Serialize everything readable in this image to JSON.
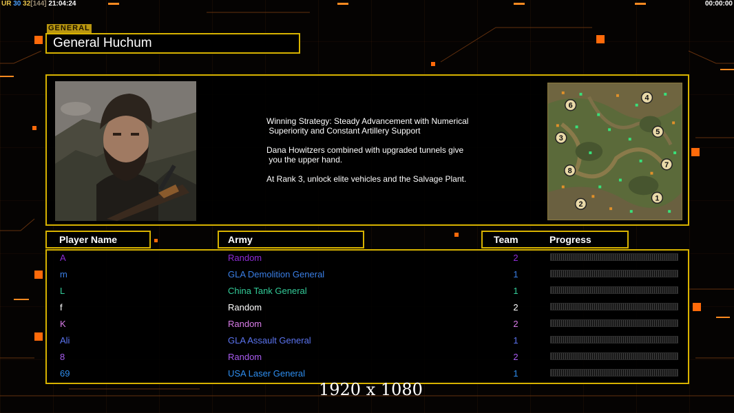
{
  "hud": {
    "left": {
      "tag": "UR",
      "a": "30",
      "b": "32",
      "c": "[144]",
      "clock": "21:04:24"
    },
    "right_timer": "00:00:00"
  },
  "section_tag": "GENERAL",
  "general_name": "General Huchum",
  "description": [
    "Winning Strategy: Steady Advancement with Numerical\n Superiority and Constant Artillery Support",
    "Dana Howitzers combined with upgraded tunnels give\n you the upper hand.",
    "At Rank 3, unlock elite vehicles and the Salvage Plant."
  ],
  "table_headers": {
    "player": "Player Name",
    "army": "Army",
    "team": "Team",
    "progress": "Progress"
  },
  "players": [
    {
      "name": "A",
      "army": "Random",
      "team": "2",
      "color": "#8e2cd6"
    },
    {
      "name": "m",
      "army": "GLA Demolition General",
      "team": "1",
      "color": "#3a7fe6"
    },
    {
      "name": "L",
      "army": "China Tank General",
      "team": "1",
      "color": "#33cc99"
    },
    {
      "name": "f",
      "army": "Random",
      "team": "2",
      "color": "#ffffff"
    },
    {
      "name": "K",
      "army": "Random",
      "team": "2",
      "color": "#d97ce9"
    },
    {
      "name": "Ali",
      "army": "GLA Assault General",
      "team": "1",
      "color": "#5b74f0"
    },
    {
      "name": "8",
      "army": "Random",
      "team": "2",
      "color": "#a95cf0"
    },
    {
      "name": "69",
      "army": "USA Laser General",
      "team": "1",
      "color": "#2e8ef0"
    }
  ],
  "minimap_slots": [
    "1",
    "2",
    "3",
    "4",
    "5",
    "6",
    "7",
    "8"
  ],
  "resolution_label": "1920 x 1080",
  "colors": {
    "frame": "#d8b300",
    "accent": "#ff7a10"
  }
}
